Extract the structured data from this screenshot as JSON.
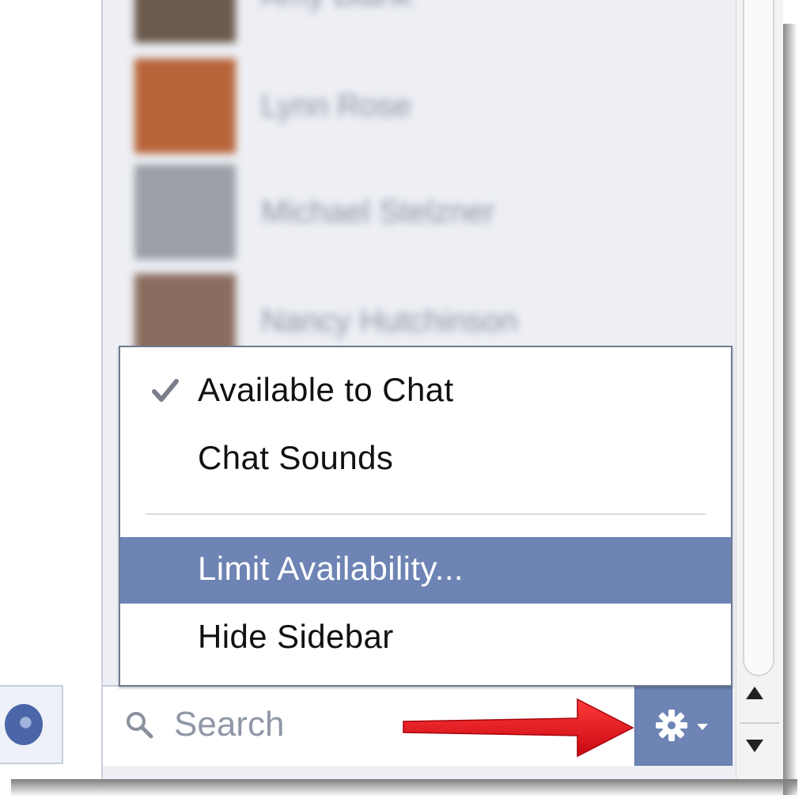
{
  "sidebar": {
    "friends": [
      {
        "name": "Amy Blank",
        "avatar_color": "#6b5a4d"
      },
      {
        "name": "Lynn Rose",
        "avatar_color": "#b8643a"
      },
      {
        "name": "Michael Stelzner",
        "avatar_color": "#9aa0a6"
      },
      {
        "name": "Nancy Hutchinson",
        "avatar_color": "#8a6d5e"
      }
    ]
  },
  "menu": {
    "items": [
      {
        "label": "Available to Chat",
        "checked": true
      },
      {
        "label": "Chat Sounds",
        "checked": false
      },
      {
        "label": "Limit Availability...",
        "highlighted": true
      },
      {
        "label": "Hide Sidebar"
      }
    ]
  },
  "search": {
    "placeholder": "Search"
  },
  "icons": {
    "globe": "globe-icon",
    "search": "search-icon",
    "options": "gear-icon",
    "caret": "caret-down-icon",
    "check": "checkmark-icon",
    "scroll_up": "arrow-up-icon",
    "scroll_down": "arrow-down-icon"
  },
  "colors": {
    "accent": "#6d84b4",
    "sidebar_bg": "#edeff4",
    "annotation_arrow": "#e3141c"
  }
}
